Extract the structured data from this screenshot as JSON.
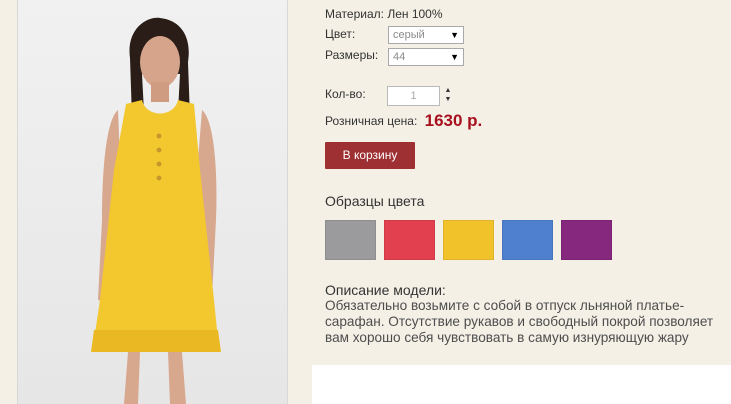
{
  "product": {
    "material_label": "Материал:",
    "material_value": "Лен 100%",
    "color_label": "Цвет:",
    "color_selected": "серый",
    "size_label": "Размеры:",
    "size_selected": "44",
    "qty_label": "Кол-во:",
    "qty_value": "1",
    "price_label": "Розничная цена:",
    "price_value": "1630 р.",
    "cart_button": "В корзину"
  },
  "swatches": {
    "title": "Образцы цвета",
    "colors": [
      "#9b9b9d",
      "#e2404f",
      "#f2c22b",
      "#4f7fcf",
      "#86287e"
    ]
  },
  "description": {
    "title": "Описание модели:",
    "text": "Обязательно возьмите с собой в отпуск льняной платье-сарафан. Отсутствие рукавов и свободный покрой позволяет вам хорошо себя чувствовать в самую изнуряющую жару"
  },
  "colors": {
    "background": "#f4f0e6",
    "button": "#9e2f33",
    "price": "#a8101e",
    "dress": "#f3c72e"
  }
}
